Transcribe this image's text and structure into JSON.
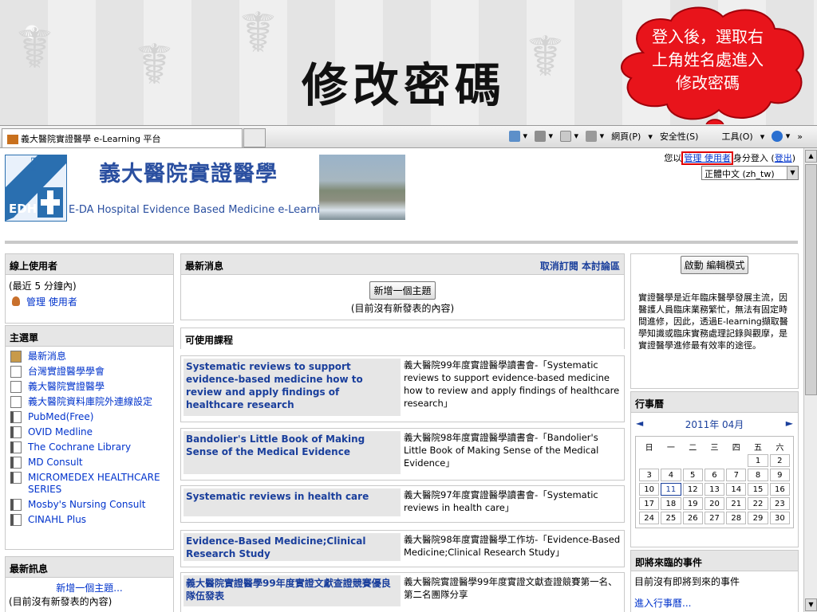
{
  "slide": {
    "title": "修改密碼",
    "callout": "登入後，選取右上角姓名處進入修改密碼"
  },
  "browser": {
    "tab_title": "義大醫院實證醫學 e-Learning 平台",
    "toolbar": {
      "page_menu": "網頁(P)",
      "safety_menu": "安全性(S)",
      "tools_menu": "工具(O)",
      "more": "»"
    }
  },
  "header": {
    "site_name": "義大醫院實證醫學",
    "site_name_en": "E-DA Hospital Evidence Based Medicine e-Learning",
    "logo_text": "EDH",
    "logo_side": "EBM",
    "login_prefix": "您以",
    "login_user": "管理 使用者",
    "login_suffix": "身分登入 (",
    "logout": "登出",
    "login_close": ")",
    "language": "正體中文 (zh_tw)"
  },
  "online_users": {
    "title": "線上使用者",
    "period": "(最近 5 分鐘內)",
    "user": "管理 使用者"
  },
  "main_menu": {
    "title": "主選單",
    "items": [
      {
        "label": "最新消息",
        "icon": "news-icon"
      },
      {
        "label": "台灣實證醫學學會",
        "icon": "page-icon"
      },
      {
        "label": "義大醫院實證醫學",
        "icon": "page-icon"
      },
      {
        "label": "義大醫院資料庫院外連線設定",
        "icon": "page-icon"
      },
      {
        "label": "PubMed(Free)",
        "icon": "resource-icon"
      },
      {
        "label": "OVID Medline",
        "icon": "resource-icon"
      },
      {
        "label": "The Cochrane Library",
        "icon": "resource-icon"
      },
      {
        "label": "MD Consult",
        "icon": "resource-icon"
      },
      {
        "label": "MICROMEDEX HEALTHCARE SERIES",
        "icon": "resource-icon"
      },
      {
        "label": "Mosby's Nursing Consult",
        "icon": "resource-icon"
      },
      {
        "label": "CINAHL Plus",
        "icon": "resource-icon"
      }
    ]
  },
  "latest_news": {
    "title": "最新訊息",
    "add_link": "新增一個主題...",
    "empty": "(目前沒有新發表的內容)"
  },
  "news_forum": {
    "title": "最新消息",
    "unsubscribe": "取消訂閱 本討論區",
    "add_button": "新增一個主題",
    "empty": "(目前沒有新發表的內容)"
  },
  "courses": {
    "title": "可使用課程",
    "items": [
      {
        "name": "Systematic reviews to support evidence-based medicine how to review and apply findings of healthcare research",
        "desc": "義大醫院99年度實證醫學讀書會-「Systematic reviews to support evidence-based medicine how to review and apply findings of healthcare research」"
      },
      {
        "name": "Bandolier's Little Book of Making Sense of the Medical Evidence",
        "desc": "義大醫院98年度實證醫學讀書會-「Bandolier's Little Book of Making Sense of the Medical Evidence」"
      },
      {
        "name": "Systematic reviews in health care",
        "desc": "義大醫院97年度實證醫學讀書會-「Systematic reviews in health care」"
      },
      {
        "name": "Evidence-Based Medicine;Clinical Research Study",
        "desc": "義大醫院98年度實證醫學工作坊-「Evidence-Based Medicine;Clinical Research Study」"
      },
      {
        "name": "義大醫院實證醫學99年度實證文獻查證競賽優良隊伍發表",
        "desc": "義大醫院實證醫學99年度實證文獻查證競賽第一名、第二名團隊分享"
      }
    ]
  },
  "edit_mode": {
    "button": "啟動 編輯模式",
    "about": "實證醫學是近年臨床醫學發展主流，因醫護人員臨床業務繁忙，無法有固定時間進修，因此，透過E-learning擷取醫學知識或臨床實務處理記錄與觀摩，是實證醫學進修最有效率的途徑。"
  },
  "calendar": {
    "title": "行事曆",
    "month": "2011年 04月",
    "prev": "◄",
    "next": "►",
    "weekdays": [
      "日",
      "一",
      "二",
      "三",
      "四",
      "五",
      "六"
    ],
    "weeks": [
      [
        "",
        "",
        "",
        "",
        "",
        "1",
        "2"
      ],
      [
        "3",
        "4",
        "5",
        "6",
        "7",
        "8",
        "9"
      ],
      [
        "10",
        "11",
        "12",
        "13",
        "14",
        "15",
        "16"
      ],
      [
        "17",
        "18",
        "19",
        "20",
        "21",
        "22",
        "23"
      ],
      [
        "24",
        "25",
        "26",
        "27",
        "28",
        "29",
        "30"
      ]
    ],
    "today": "11"
  },
  "upcoming": {
    "title": "即將來臨的事件",
    "empty": "目前沒有即將到來的事件",
    "more": "進入行事曆..."
  },
  "colors": {
    "accent": "#1a3f9c",
    "link": "#0033cc",
    "highlight": "#e00000",
    "callout": "#e8141b"
  }
}
